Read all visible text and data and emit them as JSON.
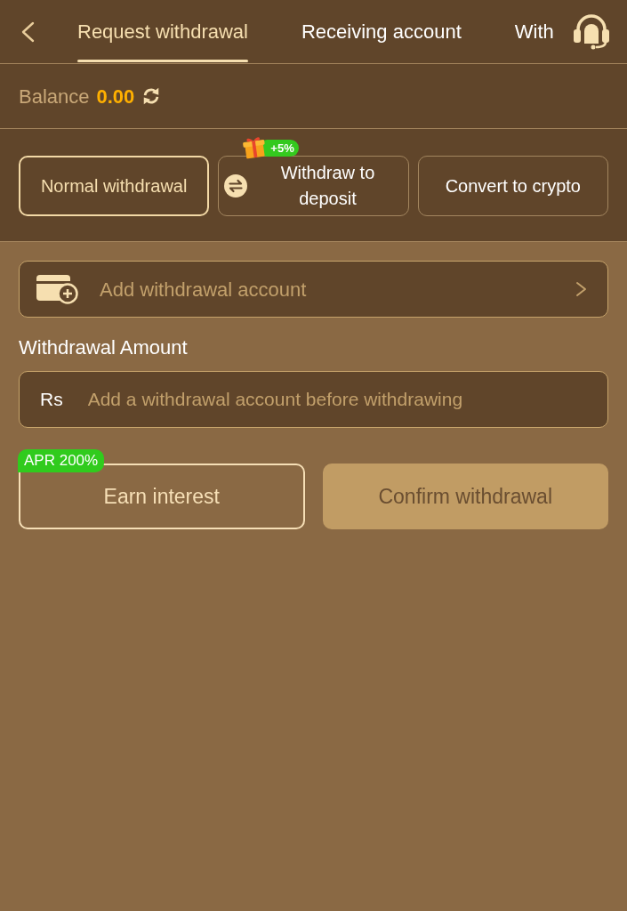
{
  "header": {
    "tabs": [
      {
        "label": "Request withdrawal",
        "selected": true
      },
      {
        "label": "Receiving account",
        "selected": false
      },
      {
        "label": "With",
        "selected": false
      }
    ]
  },
  "balance": {
    "label": "Balance",
    "amount": "0.00"
  },
  "methods": [
    {
      "kind": "plain",
      "label": "Normal withdrawal",
      "selected": true
    },
    {
      "kind": "with_icon",
      "label": "Withdraw to deposit",
      "selected": false,
      "badge": "+5%"
    },
    {
      "kind": "plain",
      "label": "Convert to crypto",
      "selected": false
    }
  ],
  "account_row": {
    "label": "Add withdrawal account"
  },
  "amount": {
    "label": "Withdrawal Amount",
    "currency": "Rs",
    "placeholder": "Add a withdrawal account before withdrawing"
  },
  "actions": [
    {
      "kind": "outline",
      "label": "Earn interest",
      "badge": "APR 200%",
      "disabled": false
    },
    {
      "kind": "filled",
      "label": "Confirm withdrawal",
      "disabled": true
    }
  ]
}
